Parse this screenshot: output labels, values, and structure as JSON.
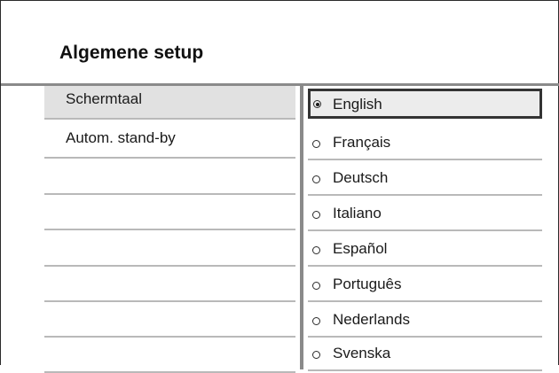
{
  "page": {
    "title": "Algemene setup"
  },
  "left_menu": {
    "items": [
      {
        "label": "Schermtaal",
        "selected": true
      },
      {
        "label": "Autom. stand-by",
        "selected": false
      },
      {
        "label": "",
        "selected": false
      },
      {
        "label": "",
        "selected": false
      },
      {
        "label": "",
        "selected": false
      },
      {
        "label": "",
        "selected": false
      },
      {
        "label": "",
        "selected": false
      },
      {
        "label": "",
        "selected": false
      }
    ]
  },
  "language_options": {
    "items": [
      {
        "label": "English",
        "checked": true
      },
      {
        "label": "Français",
        "checked": false
      },
      {
        "label": "Deutsch",
        "checked": false
      },
      {
        "label": "Italiano",
        "checked": false
      },
      {
        "label": "Español",
        "checked": false
      },
      {
        "label": "Português",
        "checked": false
      },
      {
        "label": "Nederlands",
        "checked": false
      },
      {
        "label": "Svenska",
        "checked": false
      }
    ]
  },
  "colors": {
    "selected_row_bg": "#e1e1e1",
    "highlight_border": "#333333",
    "rule": "#8a8a8a"
  }
}
